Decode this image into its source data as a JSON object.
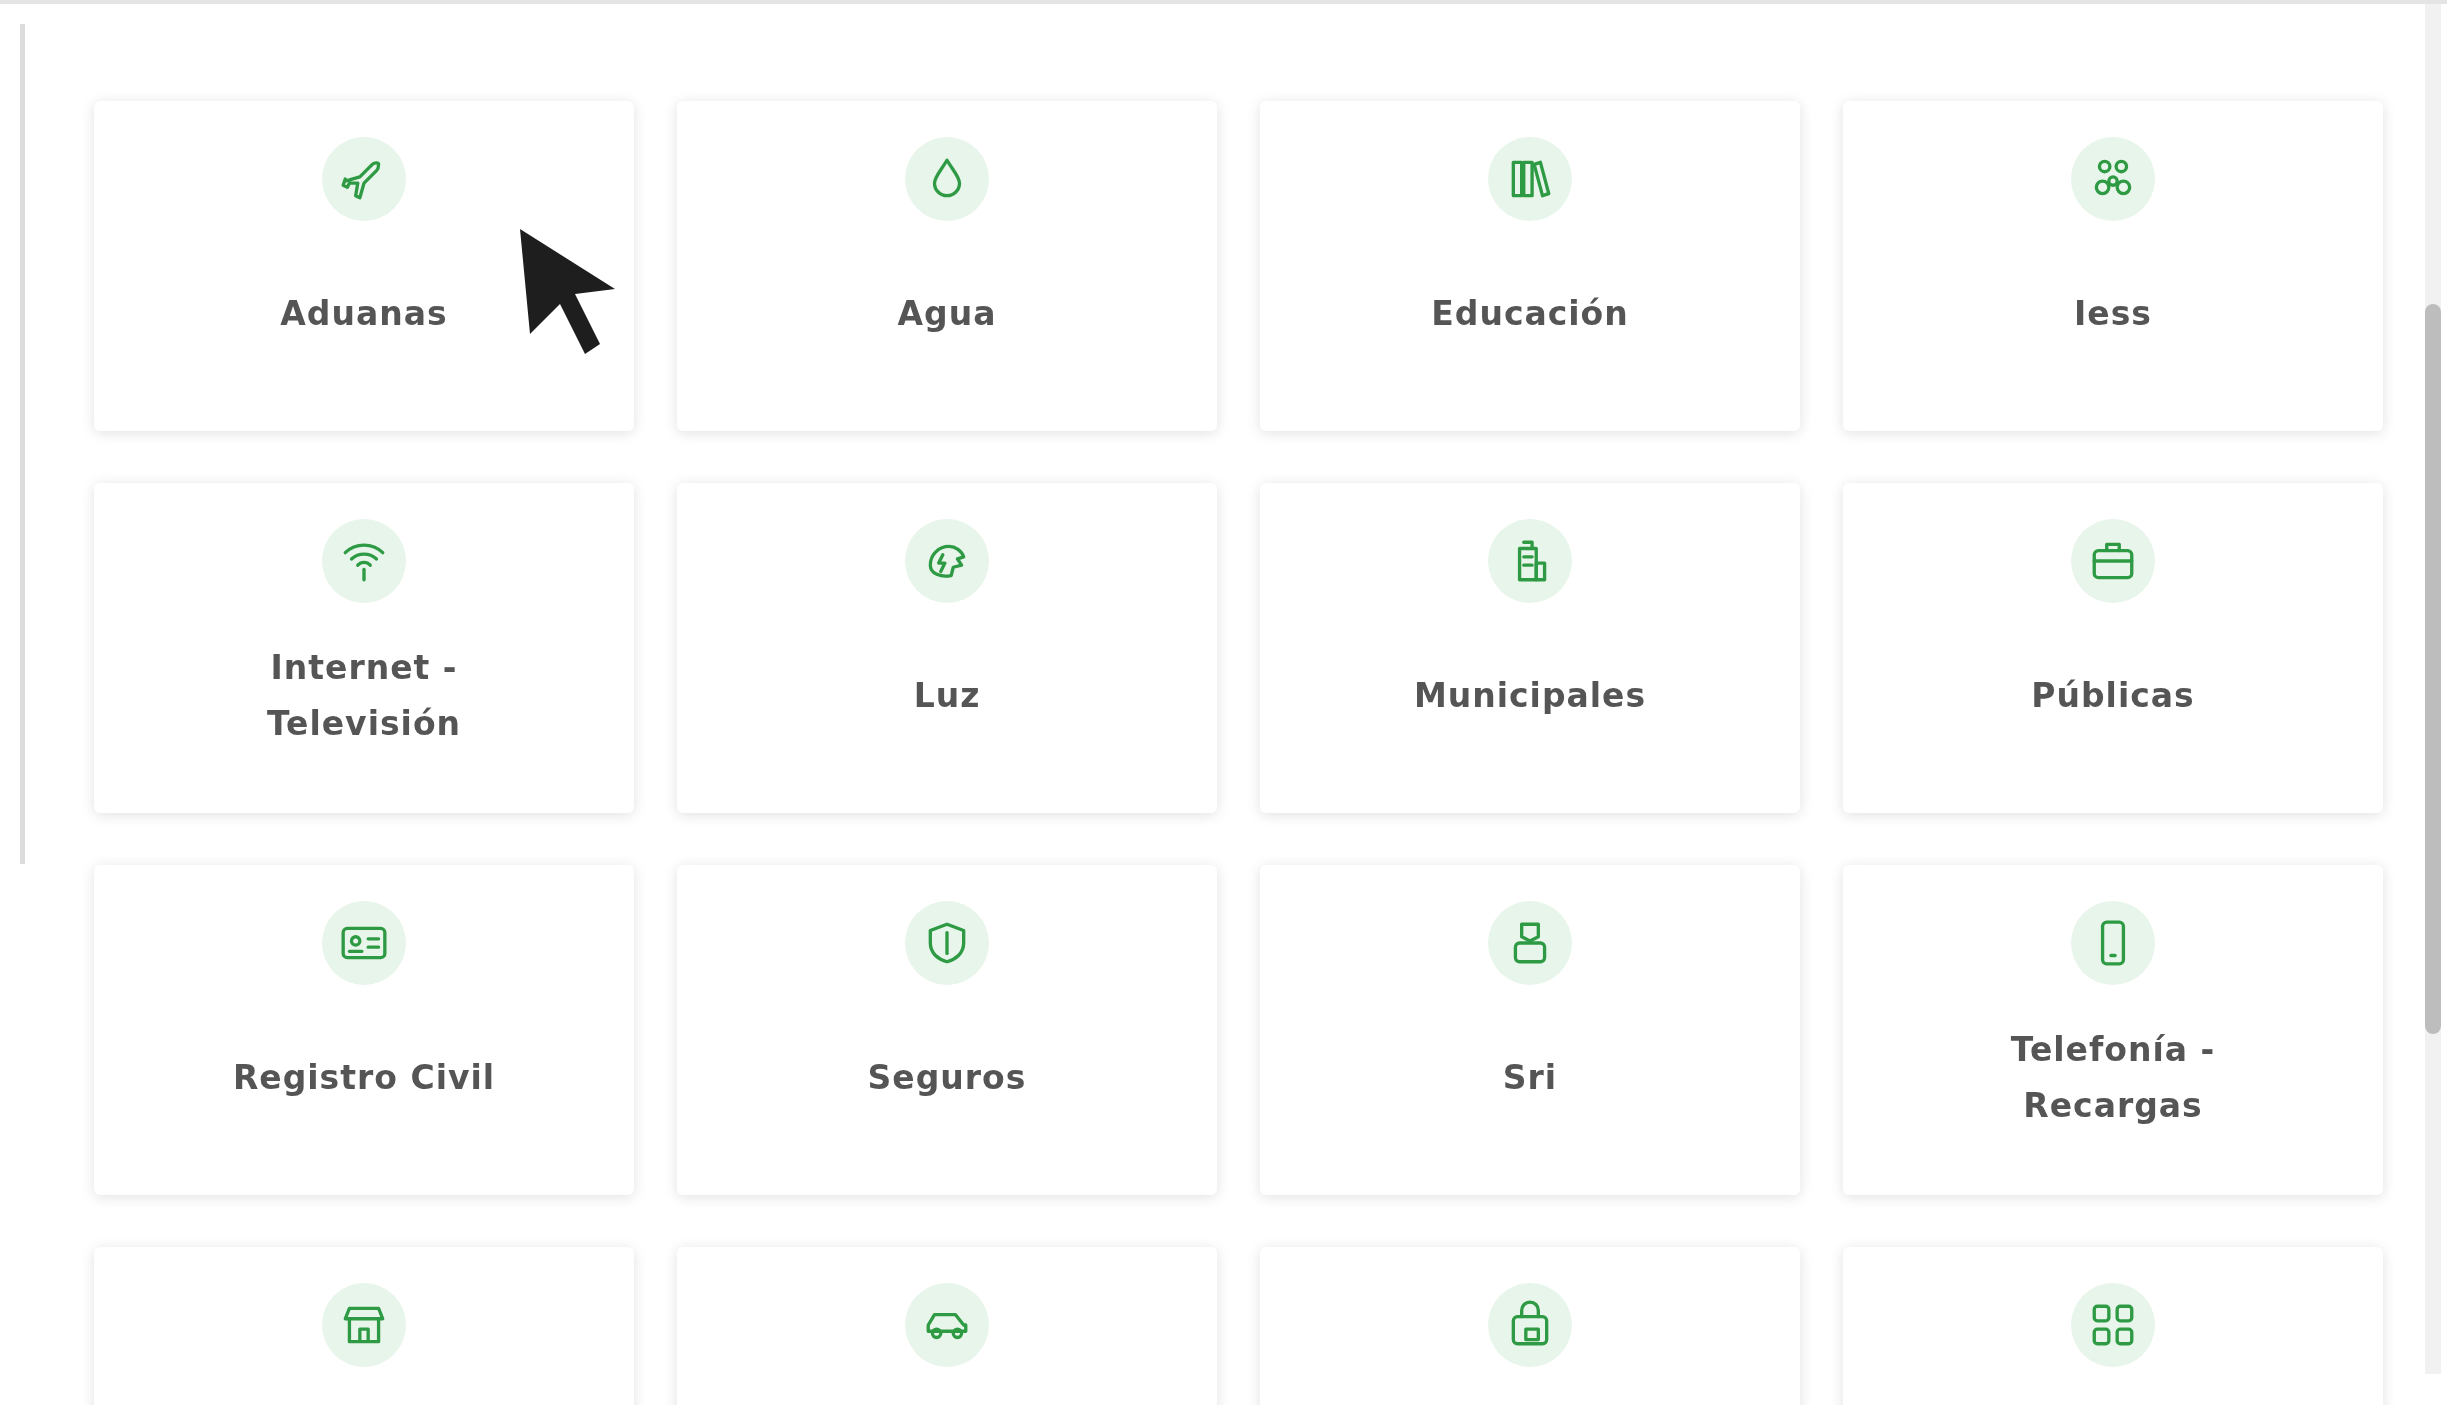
{
  "categories": [
    {
      "kind": "full",
      "label": "Aduanas"
    },
    {
      "kind": "full",
      "label": "Agua"
    },
    {
      "kind": "full",
      "label": "Educación"
    },
    {
      "kind": "full",
      "label": "Iess"
    },
    {
      "kind": "full",
      "label": "Internet - Televisión"
    },
    {
      "kind": "full",
      "label": "Luz"
    },
    {
      "kind": "full",
      "label": "Municipales"
    },
    {
      "kind": "full",
      "label": "Públicas"
    },
    {
      "kind": "full",
      "label": "Registro Civil"
    },
    {
      "kind": "full",
      "label": "Seguros"
    },
    {
      "kind": "full",
      "label": "Sri"
    },
    {
      "kind": "full",
      "label": "Telefonía - Recargas"
    },
    {
      "kind": "cut"
    },
    {
      "kind": "cut"
    },
    {
      "kind": "cut"
    },
    {
      "kind": "cut"
    }
  ]
}
